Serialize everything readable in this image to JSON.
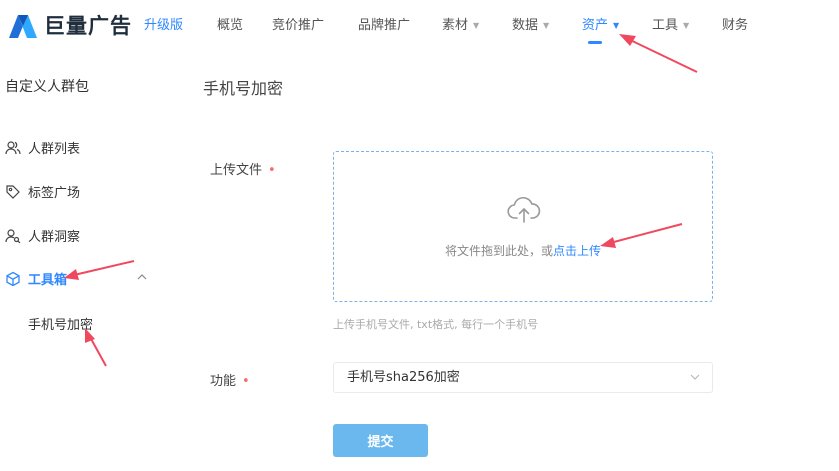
{
  "brand": {
    "name": "巨量广告",
    "badge": "升级版"
  },
  "nav": {
    "items": [
      {
        "label": "概览",
        "dropdown": false
      },
      {
        "label": "竞价推广",
        "dropdown": false
      },
      {
        "label": "品牌推广",
        "dropdown": false
      },
      {
        "label": "素材",
        "dropdown": true
      },
      {
        "label": "数据",
        "dropdown": true
      },
      {
        "label": "资产",
        "dropdown": true,
        "active": true
      },
      {
        "label": "工具",
        "dropdown": true
      },
      {
        "label": "财务",
        "dropdown": false
      }
    ]
  },
  "sidebar": {
    "title": "自定义人群包",
    "items": [
      {
        "label": "人群列表",
        "icon": "people-icon"
      },
      {
        "label": "标签广场",
        "icon": "tag-icon"
      },
      {
        "label": "人群洞察",
        "icon": "person-search-icon"
      },
      {
        "label": "工具箱",
        "icon": "cube-icon",
        "active": true,
        "expanded": true
      }
    ],
    "sub_item": "手机号加密"
  },
  "main": {
    "title": "手机号加密",
    "upload_label": "上传文件",
    "required_mark": "•",
    "upload_text": "将文件拖到此处，或",
    "upload_link": "点击上传",
    "upload_hint": "上传手机号文件, txt格式, 每行一个手机号",
    "function_label": "功能",
    "function_value": "手机号sha256加密",
    "submit_label": "提交"
  },
  "colors": {
    "accent": "#2f88ff",
    "submit": "#6ab8ee",
    "arrow": "#f0485f",
    "required": "#f56c6c"
  }
}
